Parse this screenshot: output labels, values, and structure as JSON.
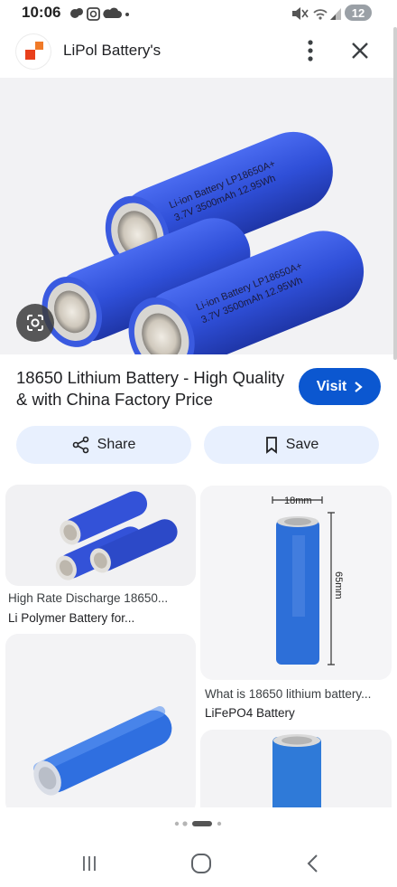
{
  "status_bar": {
    "time": "10:06",
    "battery": "12"
  },
  "header": {
    "site_name": "LiPol Battery's",
    "logo_colors": [
      "#e8401c",
      "#f07a28"
    ]
  },
  "main_image": {
    "battery_text_line1": "Li-ion Battery LP18650A+",
    "battery_text_line2": "3.7V 3500mAh 12.95Wh"
  },
  "result": {
    "title": "18650 Lithium Battery - High Quality & with China Factory Price",
    "visit_label": "Visit"
  },
  "actions": {
    "share_label": "Share",
    "save_label": "Save"
  },
  "related": [
    {
      "line1": "High Rate Discharge 18650...",
      "line2": "Li Polymer Battery for..."
    },
    {
      "line1": "What is 18650 lithium battery...",
      "line2": "LiFePO4 Battery",
      "dim_width": "18mm",
      "dim_height": "65mm"
    },
    {
      "line1": "",
      "line2": ""
    },
    {
      "line1": "",
      "line2": ""
    }
  ],
  "colors": {
    "accent": "#0b57d0",
    "pill_bg": "#e8f0fe",
    "battery_blue": "#2f4fd0"
  }
}
